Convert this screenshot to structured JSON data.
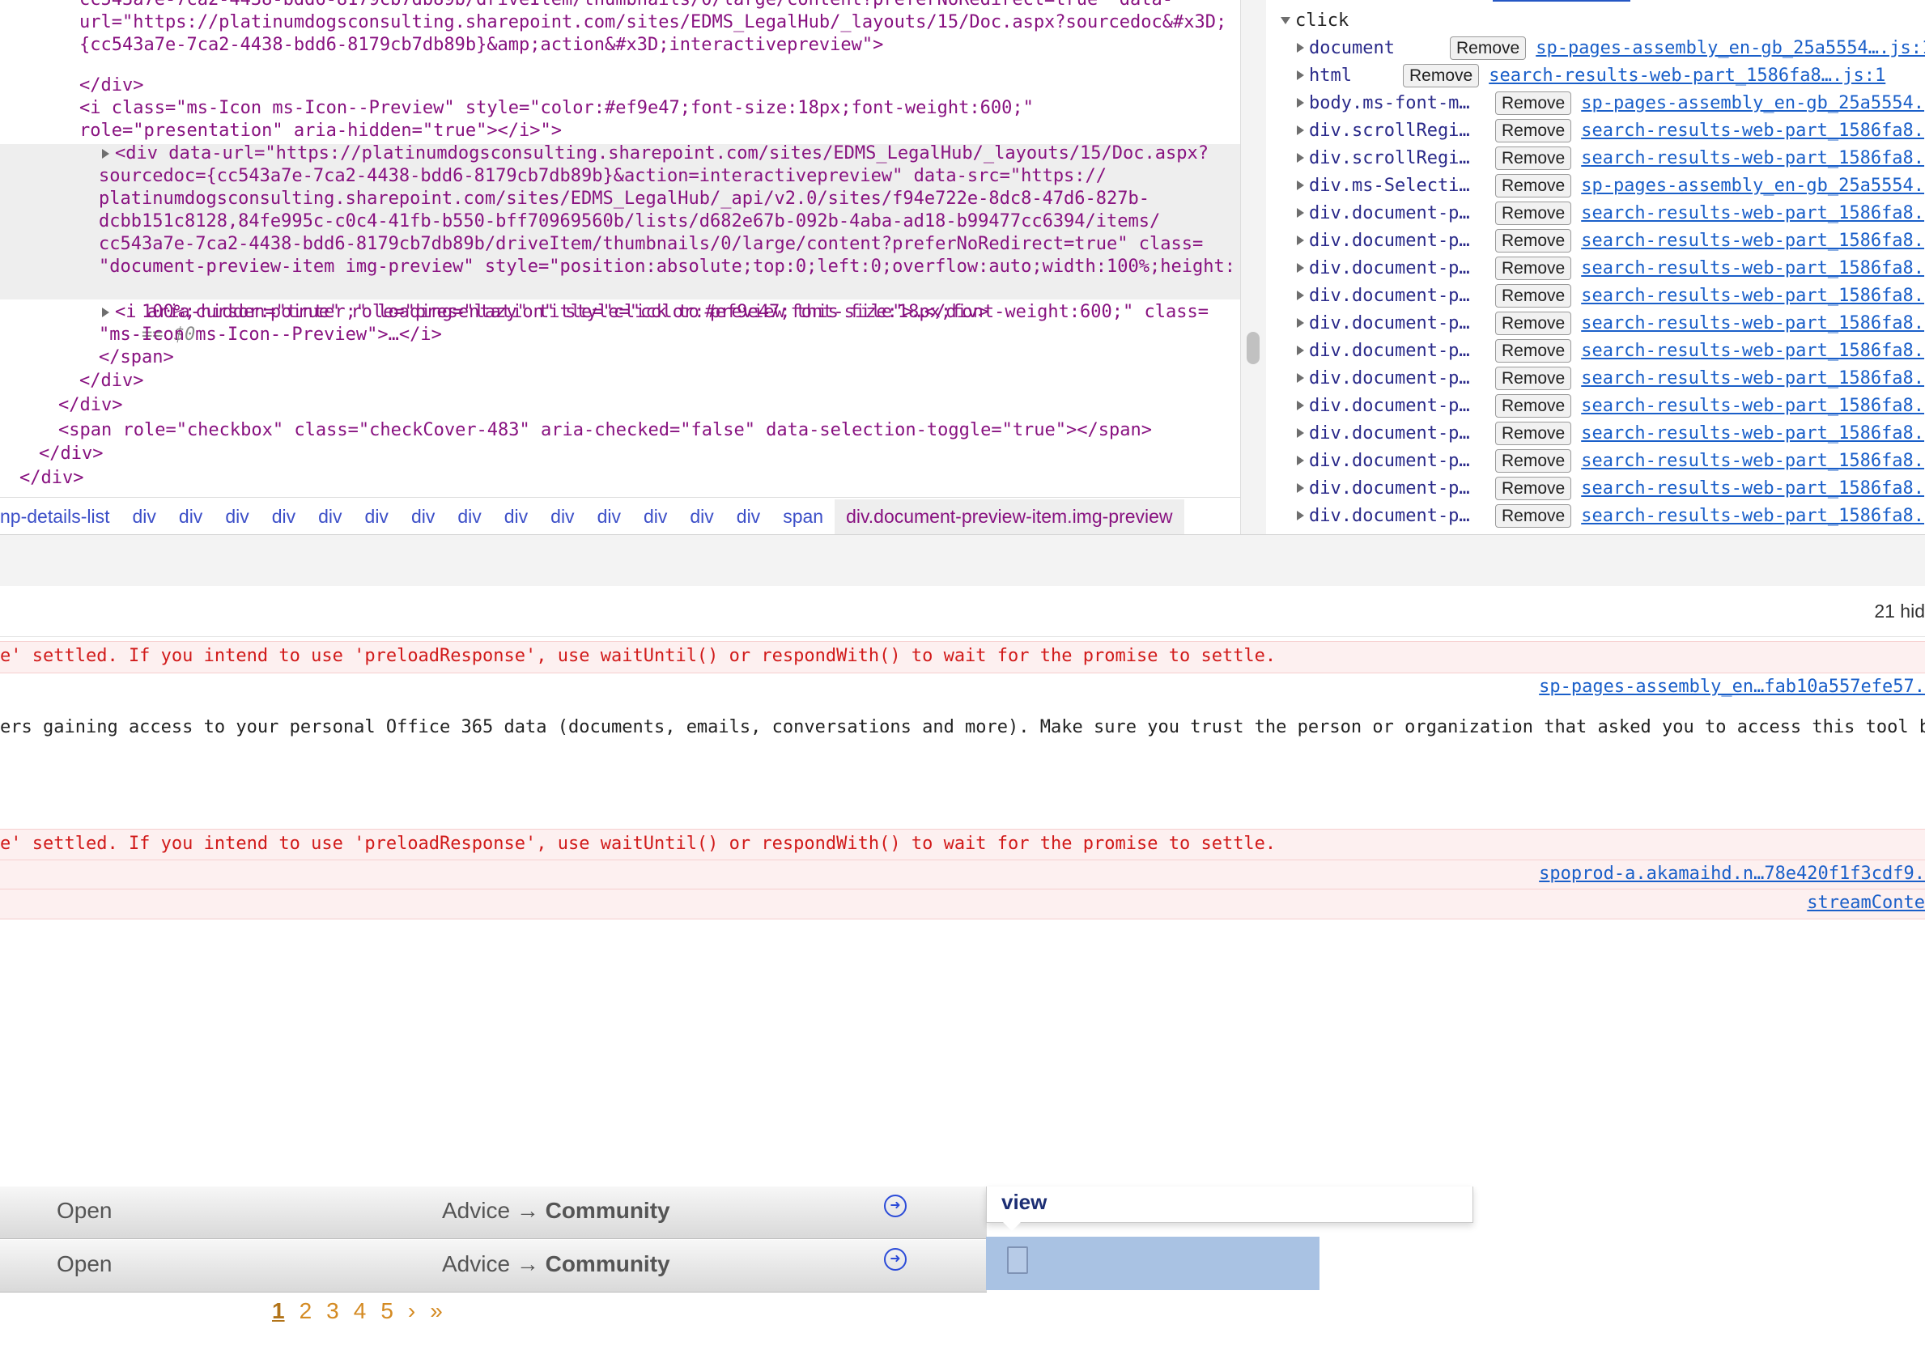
{
  "elements": {
    "lines": [
      {
        "indent": 98,
        "html_text": "cc543a7e-7ca2-4438-bdd6-8179cb7db89b/driveItem/thumbnails/0/large/content?preferNoRedirect=true\" data-"
      },
      {
        "indent": 98,
        "html_text": "url=\"https://platinumdogsconsulting.sharepoint.com/sites/EDMS_LegalHub/_layouts/15/Doc.aspx?sourcedoc&#x3D;"
      },
      {
        "indent": 98,
        "html_text": "{cc543a7e-7ca2-4438-bdd6-8179cb7db89b}&amp;action&#x3D;interactivepreview\">"
      },
      {
        "indent": 98,
        "html_text": "</div>"
      },
      {
        "indent": 98,
        "html_text": "<i class=\"ms-Icon ms-Icon--Preview\" style=\"color:#ef9e47;font-size:18px;font-weight:600;\""
      },
      {
        "indent": 98,
        "html_text": "role=\"presentation\" aria-hidden=\"true\"></i>\">"
      }
    ],
    "selected": [
      "<div data-url=\"https://platinumdogsconsulting.sharepoint.com/sites/EDMS_LegalHub/_layouts/15/Doc.aspx?",
      "sourcedoc={cc543a7e-7ca2-4438-bdd6-8179cb7db89b}&action=interactivepreview\" data-src=\"https://",
      "platinumdogsconsulting.sharepoint.com/sites/EDMS_LegalHub/_api/v2.0/sites/f94e722e-8dc8-47d6-827b-",
      "dcbb151c8128,84fe995c-c0c4-41fb-b550-bff70969560b/lists/d682e67b-092b-4aba-ad18-b99477cc6394/items/",
      "cc543a7e-7ca2-4438-bdd6-8179cb7db89b/driveItem/thumbnails/0/large/content?preferNoRedirect=true\" class=",
      "\"document-preview-item img-preview\" style=\"position:absolute;top:0;left:0;overflow:auto;width:100%;height:",
      "100%;cursor:pointer;\" loading=\"lazy\" title=\"click to preview this file\">…</div>"
    ],
    "selected_marker": "== $0",
    "after": [
      "<i aria-hidden=\"true\" role=\"presentation\" style=\"color:#ef9e47;font-size:18px;font-weight:600;\" class=",
      "\"ms-Icon ms-Icon--Preview\">…</i>",
      "</span>",
      "</div>",
      "</div>",
      "<span role=\"checkbox\" class=\"checkCover-483\" aria-checked=\"false\" data-selection-toggle=\"true\"></span>",
      "</div>",
      "</div>"
    ]
  },
  "breadcrumbs": [
    "np-details-list",
    "div",
    "div",
    "div",
    "div",
    "div",
    "div",
    "div",
    "div",
    "div",
    "div",
    "div",
    "div",
    "div",
    "div",
    "span",
    "div.document-preview-item.img-preview"
  ],
  "listeners": {
    "group": "click",
    "remove_label": "Remove",
    "rows": [
      {
        "node": "document",
        "source": "sp-pages-assembly_en-gb_25a5554….js:1"
      },
      {
        "node": "html",
        "source": "search-results-web-part_1586fa8….js:1"
      },
      {
        "node": "body.ms-font-m…",
        "source": "sp-pages-assembly_en-gb_25a5554."
      },
      {
        "node": "div.scrollRegi…",
        "source": "search-results-web-part_1586fa8."
      },
      {
        "node": "div.scrollRegi…",
        "source": "search-results-web-part_1586fa8."
      },
      {
        "node": "div.ms-Selecti…",
        "source": "sp-pages-assembly_en-gb_25a5554."
      },
      {
        "node": "div.document-p…",
        "source": "search-results-web-part_1586fa8."
      },
      {
        "node": "div.document-p…",
        "source": "search-results-web-part_1586fa8."
      },
      {
        "node": "div.document-p…",
        "source": "search-results-web-part_1586fa8."
      },
      {
        "node": "div.document-p…",
        "source": "search-results-web-part_1586fa8."
      },
      {
        "node": "div.document-p…",
        "source": "search-results-web-part_1586fa8."
      },
      {
        "node": "div.document-p…",
        "source": "search-results-web-part_1586fa8."
      },
      {
        "node": "div.document-p…",
        "source": "search-results-web-part_1586fa8."
      },
      {
        "node": "div.document-p…",
        "source": "search-results-web-part_1586fa8."
      },
      {
        "node": "div.document-p…",
        "source": "search-results-web-part_1586fa8."
      },
      {
        "node": "div.document-p…",
        "source": "search-results-web-part_1586fa8."
      },
      {
        "node": "div.document-p…",
        "source": "search-results-web-part_1586fa8."
      },
      {
        "node": "div.document-p…",
        "source": "search-results-web-part_1586fa8."
      }
    ]
  },
  "console": {
    "hidden_count": "21 hid",
    "msg1": "e' settled. If you intend to use 'preloadResponse', use waitUntil() or respondWith() to wait for the promise to settle.",
    "link1": "sp-pages-assembly_en…fab10a557efe57.",
    "msg2": "ers gaining access to your personal Office 365 data (documents, emails, conversations and more). Make sure you trust the person or organization that asked you to access this tool be",
    "msg3": "e' settled. If you intend to use 'preloadResponse', use waitUntil() or respondWith() to wait for the promise to settle.",
    "link3": "spoprod-a.akamaihd.n…78e420f1f3cdf9.",
    "link4": "streamConte"
  },
  "page": {
    "rows": [
      {
        "status": "Open",
        "path_prefix": "Advice →",
        "path_leaf": "Community"
      },
      {
        "status": "Open",
        "path_prefix": "Advice →",
        "path_leaf": "Community"
      }
    ],
    "tooltip": "view",
    "pager": [
      "1",
      "2",
      "3",
      "4",
      "5",
      "›",
      "»"
    ]
  }
}
